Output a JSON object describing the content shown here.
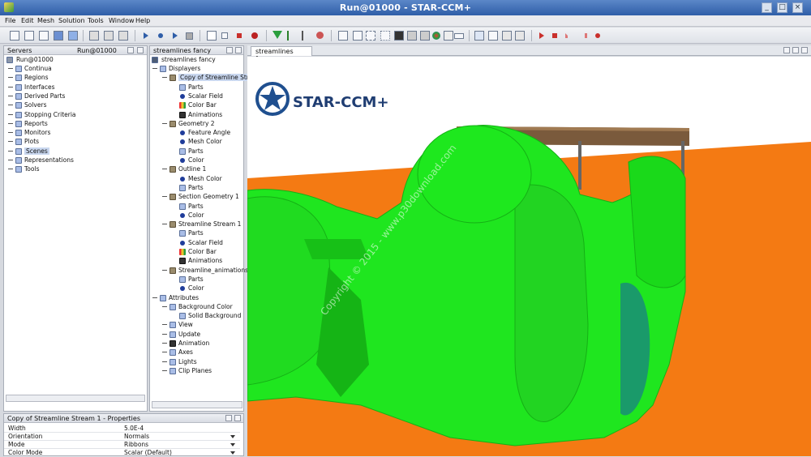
{
  "window": {
    "title": "Run@01000 - STAR-CCM+"
  },
  "menu": [
    "File",
    "Edit",
    "Mesh",
    "Solution",
    "Tools",
    "Window",
    "Help"
  ],
  "servers_panel": {
    "tabs": [
      "Servers",
      "Run@01000"
    ],
    "root": "Run@01000",
    "items": [
      "Continua",
      "Regions",
      "Interfaces",
      "Derived Parts",
      "Solvers",
      "Stopping Criteria",
      "Reports",
      "Monitors",
      "Plots",
      "Scenes",
      "Representations",
      "Tools"
    ],
    "selected": "Scenes"
  },
  "scene_panel": {
    "tab": "streamlines fancy",
    "root": "streamlines fancy",
    "rows": [
      {
        "label": "Displayers",
        "depth": 1,
        "icon": "folder-icon"
      },
      {
        "label": "Copy of Streamline Stre",
        "depth": 2,
        "icon": "displayer-icon",
        "selected": true
      },
      {
        "label": "Parts",
        "depth": 3,
        "icon": "folder-icon"
      },
      {
        "label": "Scalar Field",
        "depth": 3,
        "icon": "ball-icon"
      },
      {
        "label": "Color Bar",
        "depth": 3,
        "icon": "colorbar-icon"
      },
      {
        "label": "Animations",
        "depth": 3,
        "icon": "film-icon"
      },
      {
        "label": "Geometry 2",
        "depth": 2,
        "icon": "displayer-icon"
      },
      {
        "label": "Feature Angle",
        "depth": 3,
        "icon": "ball-icon"
      },
      {
        "label": "Mesh Color",
        "depth": 3,
        "icon": "ball-icon"
      },
      {
        "label": "Parts",
        "depth": 3,
        "icon": "folder-icon"
      },
      {
        "label": "Color",
        "depth": 3,
        "icon": "ball-icon"
      },
      {
        "label": "Outline 1",
        "depth": 2,
        "icon": "displayer-icon"
      },
      {
        "label": "Mesh Color",
        "depth": 3,
        "icon": "ball-icon"
      },
      {
        "label": "Parts",
        "depth": 3,
        "icon": "folder-icon"
      },
      {
        "label": "Section Geometry 1",
        "depth": 2,
        "icon": "displayer-icon"
      },
      {
        "label": "Parts",
        "depth": 3,
        "icon": "folder-icon"
      },
      {
        "label": "Color",
        "depth": 3,
        "icon": "ball-icon"
      },
      {
        "label": "Streamline Stream 1",
        "depth": 2,
        "icon": "displayer-icon"
      },
      {
        "label": "Parts",
        "depth": 3,
        "icon": "folder-icon"
      },
      {
        "label": "Scalar Field",
        "depth": 3,
        "icon": "ball-icon"
      },
      {
        "label": "Color Bar",
        "depth": 3,
        "icon": "colorbar-icon"
      },
      {
        "label": "Animations",
        "depth": 3,
        "icon": "film-icon"
      },
      {
        "label": "Streamline_animations",
        "depth": 2,
        "icon": "displayer-icon"
      },
      {
        "label": "Parts",
        "depth": 3,
        "icon": "folder-icon"
      },
      {
        "label": "Color",
        "depth": 3,
        "icon": "ball-icon"
      },
      {
        "label": "Attributes",
        "depth": 1,
        "icon": "folder-icon"
      },
      {
        "label": "Background Color",
        "depth": 2,
        "icon": "folder-icon"
      },
      {
        "label": "Solid Background",
        "depth": 3,
        "icon": "swatch-icon"
      },
      {
        "label": "View",
        "depth": 2,
        "icon": "camera-icon"
      },
      {
        "label": "Update",
        "depth": 2,
        "icon": "update-icon"
      },
      {
        "label": "Animation",
        "depth": 2,
        "icon": "film-icon"
      },
      {
        "label": "Axes",
        "depth": 2,
        "icon": "axes-icon"
      },
      {
        "label": "Lights",
        "depth": 2,
        "icon": "folder-icon"
      },
      {
        "label": "Clip Planes",
        "depth": 2,
        "icon": "folder-icon"
      }
    ]
  },
  "properties": {
    "title": "Copy of Streamline Stream 1 - Properties",
    "rows": [
      {
        "key": "Width",
        "value": "5.0E-4"
      },
      {
        "key": "Orientation",
        "value": "Normals"
      },
      {
        "key": "Mode",
        "value": "Ribbons"
      },
      {
        "key": "Color Mode",
        "value": "Scalar (Default)"
      }
    ]
  },
  "viewport": {
    "tab": "streamlines fancy",
    "logo_text": "STAR-CCM+",
    "watermark": "Copyright © 2015 - www.p30download.com",
    "colors": {
      "floor": "#f47a13",
      "car": "#1fe61f",
      "accent": "#1f4f8f"
    }
  }
}
